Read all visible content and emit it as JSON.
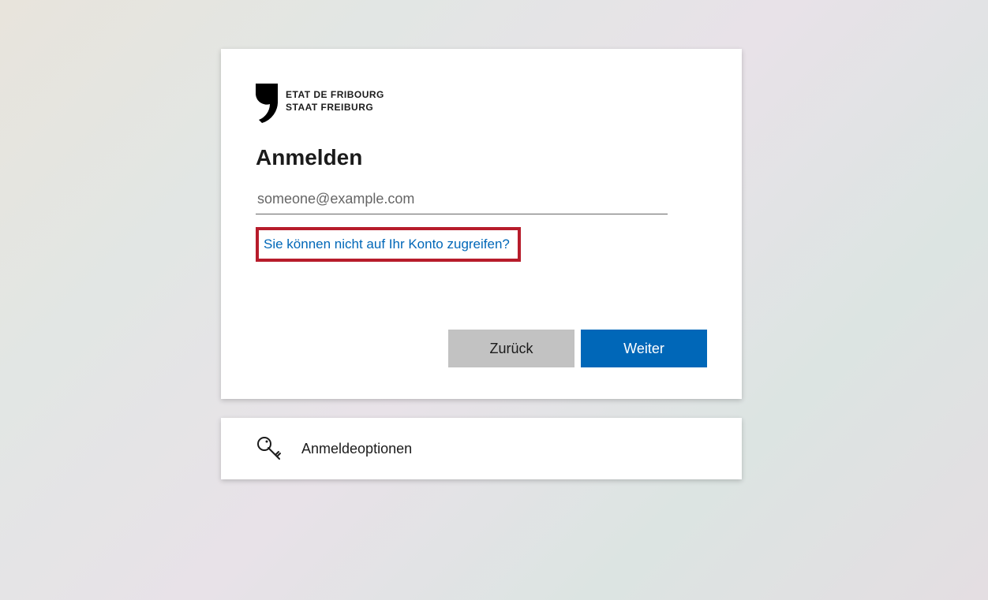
{
  "logo": {
    "line1": "ETAT DE FRIBOURG",
    "line2": "STAAT FREIBURG"
  },
  "heading": "Anmelden",
  "email": {
    "placeholder": "someone@example.com",
    "value": ""
  },
  "help_link": "Sie können nicht auf Ihr Konto zugreifen?",
  "buttons": {
    "back": "Zurück",
    "next": "Weiter"
  },
  "options_label": "Anmeldeoptionen"
}
